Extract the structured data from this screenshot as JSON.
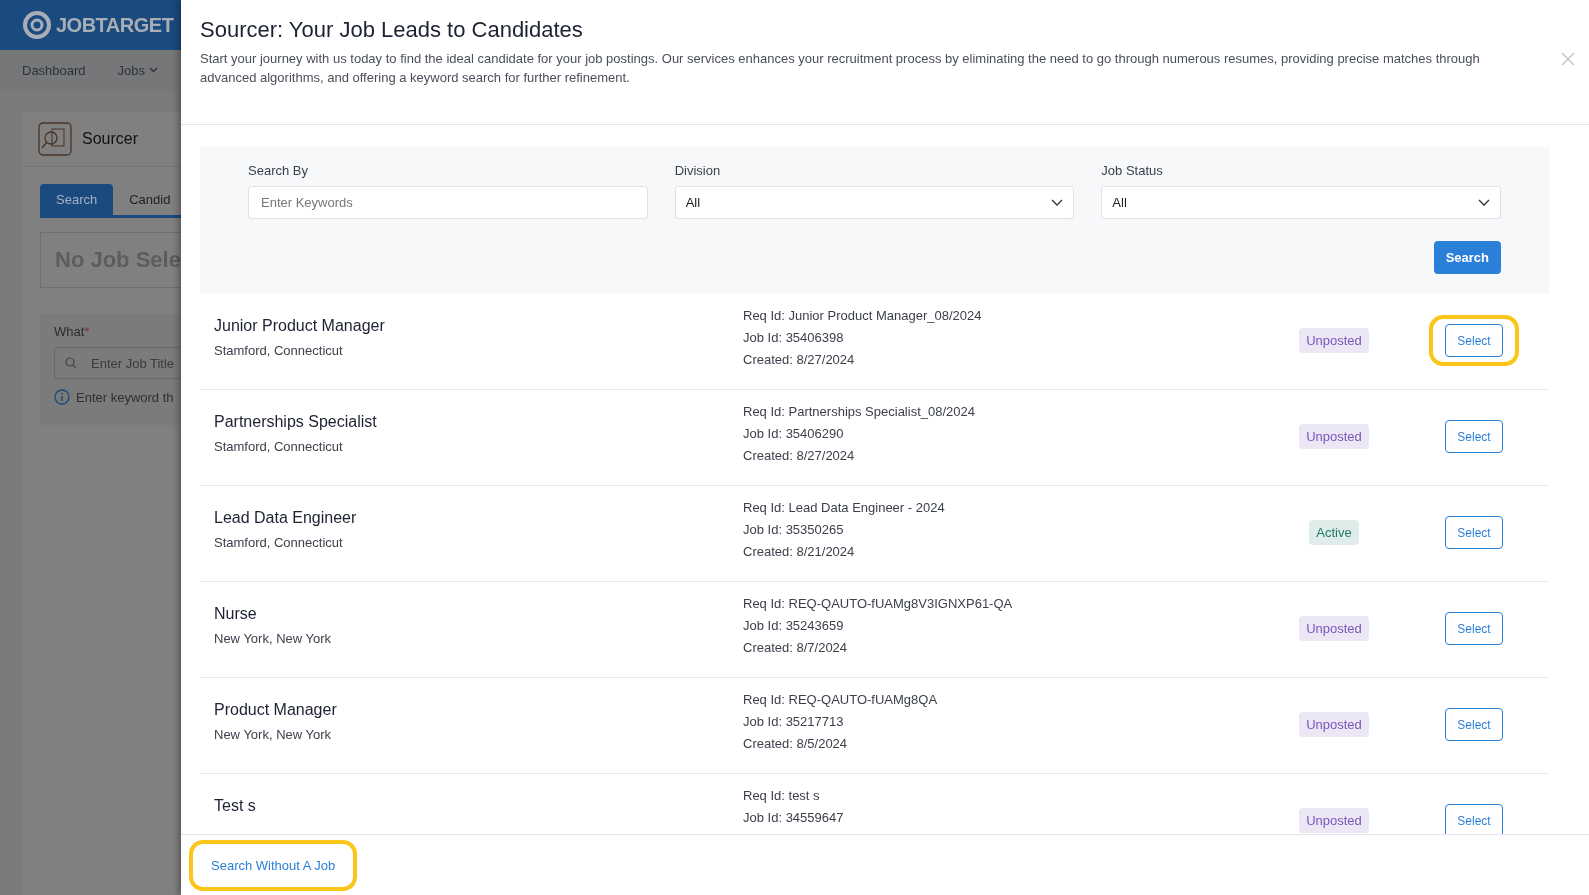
{
  "background": {
    "logo": "JOBTARGET",
    "nav": [
      {
        "label": "Dashboard",
        "dropdown": false
      },
      {
        "label": "Jobs",
        "dropdown": true
      }
    ],
    "card_title": "Sourcer",
    "tabs": [
      {
        "label": "Search",
        "selected": true
      },
      {
        "label": "Candid",
        "selected": false
      }
    ],
    "job_banner": "No Job Sele",
    "what_label": "What",
    "required_mark": "*",
    "what_placeholder": "Enter Job Title",
    "hint": "Enter keyword th"
  },
  "modal": {
    "title": "Sourcer: Your Job Leads to Candidates",
    "description": "Start your journey with us today to find the ideal candidate for your job postings. Our services enhances your recruitment process by eliminating the need to go through numerous resumes, providing precise matches through advanced algorithms, and offering a keyword search for further refinement.",
    "filters": {
      "search_by": {
        "label": "Search By",
        "placeholder": "Enter Keywords"
      },
      "division": {
        "label": "Division",
        "value": "All"
      },
      "job_status": {
        "label": "Job Status",
        "value": "All"
      },
      "search_button": "Search"
    },
    "jobs": [
      {
        "title": "Junior Product Manager",
        "location": "Stamford, Connecticut",
        "req_id": "Req Id: Junior Product Manager_08/2024",
        "job_id": "Job Id: 35406398",
        "created": "Created: 8/27/2024",
        "status": "Unposted",
        "color": "#7a55b8",
        "select_label": "Select",
        "highlighted": true
      },
      {
        "title": "Partnerships Specialist",
        "location": "Stamford, Connecticut",
        "req_id": "Req Id: Partnerships Specialist_08/2024",
        "job_id": "Job Id: 35406290",
        "created": "Created: 8/27/2024",
        "status": "Unposted",
        "color": "#7a55b8",
        "select_label": "Select",
        "highlighted": false
      },
      {
        "title": "Lead Data Engineer",
        "location": "Stamford, Connecticut",
        "req_id": "Req Id: Lead Data Engineer - 2024",
        "job_id": "Job Id: 35350265",
        "created": "Created: 8/21/2024",
        "status": "Active",
        "color": "#1f7a6b",
        "select_label": "Select",
        "highlighted": false
      },
      {
        "title": "Nurse",
        "location": "New York, New York",
        "req_id": "Req Id: REQ-QAUTO-fUAMg8V3IGNXP61-QA",
        "job_id": "Job Id: 35243659",
        "created": "Created: 8/7/2024",
        "status": "Unposted",
        "color": "#7a55b8",
        "select_label": "Select",
        "highlighted": false
      },
      {
        "title": "Product Manager",
        "location": "New York, New York",
        "req_id": "Req Id: REQ-QAUTO-fUAMg8QA",
        "job_id": "Job Id: 35217713",
        "created": "Created: 8/5/2024",
        "status": "Unposted",
        "color": "#7a55b8",
        "select_label": "Select",
        "highlighted": false
      },
      {
        "title": "Test s",
        "req_id": "Req Id: test s",
        "job_id": "Job Id: 34559647",
        "status": "Unposted",
        "color": "#7a55b8",
        "select_label": "Select",
        "highlighted": false
      }
    ],
    "footer_button": {
      "label": "Search Without A Job",
      "highlighted": true
    }
  }
}
